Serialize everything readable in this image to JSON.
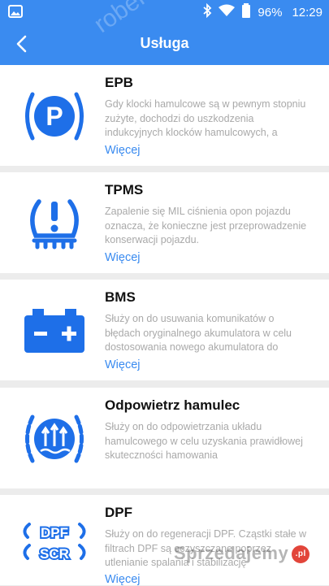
{
  "status_bar": {
    "battery": "96%",
    "time": "12:29"
  },
  "header": {
    "title": "Usługa"
  },
  "services": [
    {
      "name": "EPB",
      "description": "Gdy klocki hamulcowe są w pewnym stopniu zużyte, dochodzi do uszkodzenia indukcyjnych klocków hamulcowych, a",
      "more": "Więcej",
      "icon": "parking-brake-icon"
    },
    {
      "name": "TPMS",
      "description": "Zapalenie się MIL ciśnienia opon pojazdu oznacza, że konieczne jest przeprowadzenie konserwacji pojazdu.",
      "more": "Więcej",
      "icon": "tire-pressure-icon"
    },
    {
      "name": "BMS",
      "description": "Służy on do usuwania komunikatów o błędach oryginalnego akumulatora w celu dostosowania nowego akumulatora do",
      "more": "Więcej",
      "icon": "battery-icon"
    },
    {
      "name": "Odpowietrz hamulec",
      "description": "Służy on do odpowietrzania układu hamulcowego w celu uzyskania prawidłowej skuteczności hamowania",
      "more": "Więcej",
      "icon": "brake-bleed-icon"
    },
    {
      "name": "DPF",
      "description": "Służy on do regeneracji DPF. Cząstki stałe w filtrach DPF są oczyszczane poprzez utlenianie spalania i stabilizację",
      "more": "Więcej",
      "icon": "dpf-scr-icon",
      "icon_text_top": "DPF",
      "icon_text_bottom": "SCR"
    }
  ],
  "watermarks": {
    "top": "robert",
    "bottom": "Sprzedajemy",
    "badge": ".pl"
  },
  "colors": {
    "accent": "#3a8bf0",
    "icon_blue": "#1e6fe8"
  }
}
